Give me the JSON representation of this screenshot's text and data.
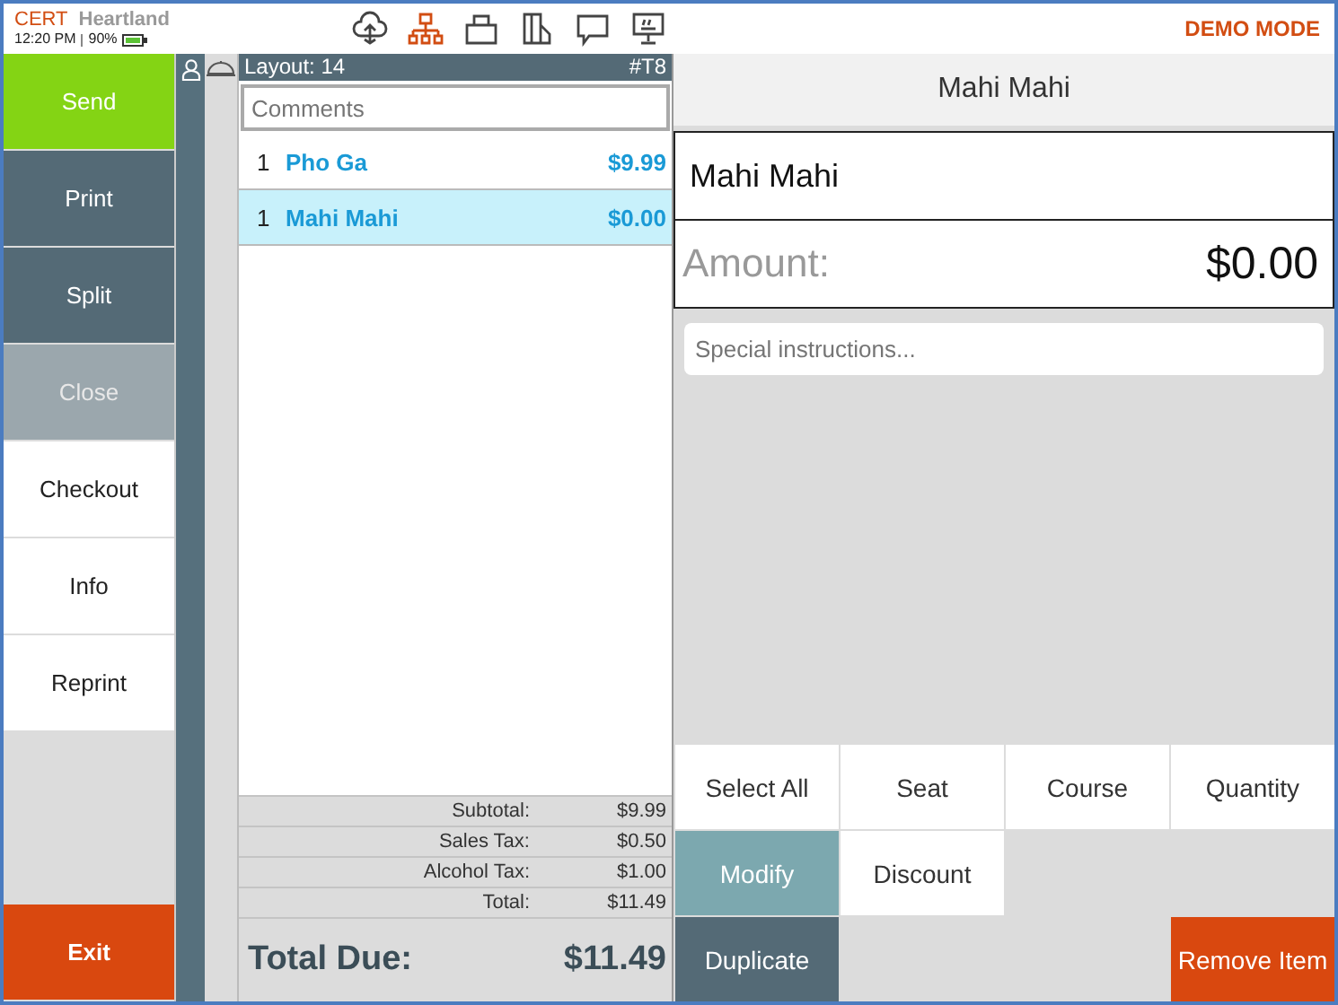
{
  "status": {
    "mode": "CERT",
    "brand": "Heartland",
    "time": "12:20 PM",
    "battery": "90%",
    "demo": "DEMO MODE"
  },
  "toolbar_icons": [
    {
      "kind": "cloud",
      "selected": false
    },
    {
      "kind": "network",
      "selected": true
    },
    {
      "kind": "printer",
      "selected": false
    },
    {
      "kind": "card",
      "selected": false
    },
    {
      "kind": "chat",
      "selected": false
    },
    {
      "kind": "terminal",
      "selected": false
    }
  ],
  "side_buttons": [
    {
      "label": "Send",
      "kind": "primary"
    },
    {
      "label": "Print",
      "kind": "dark"
    },
    {
      "label": "Split",
      "kind": "dark"
    },
    {
      "label": "Close",
      "kind": "disabled"
    },
    {
      "label": "Checkout",
      "kind": "plain"
    },
    {
      "label": "Info",
      "kind": "plain"
    },
    {
      "label": "Reprint",
      "kind": "plain"
    }
  ],
  "exit_button": "Exit",
  "order": {
    "layout": "Layout: 14",
    "table": "#T8",
    "comments_placeholder": "Comments",
    "items": [
      {
        "qty": "1",
        "name": "Pho Ga",
        "price": "$9.99",
        "selected": false
      },
      {
        "qty": "1",
        "name": "Mahi Mahi",
        "price": "$0.00",
        "selected": true
      }
    ],
    "totals": [
      {
        "label": "Subtotal:",
        "value": "$9.99"
      },
      {
        "label": "Sales Tax:",
        "value": "$0.50"
      },
      {
        "label": "Alcohol Tax:",
        "value": "$1.00"
      },
      {
        "label": "Total:",
        "value": "$11.49"
      }
    ],
    "total_due_label": "Total Due:",
    "total_due": "$11.49"
  },
  "detail": {
    "title": "Mahi Mahi",
    "name": "Mahi Mahi",
    "amount_label": "Amount:",
    "amount": "$0.00",
    "placeholder": "Special instructions..."
  },
  "actions": [
    {
      "label": "Select All",
      "kind": "plain"
    },
    {
      "label": "Seat",
      "kind": "plain"
    },
    {
      "label": "Course",
      "kind": "plain"
    },
    {
      "label": "Quantity",
      "kind": "plain"
    },
    {
      "label": "Modify",
      "kind": "teal"
    },
    {
      "label": "Discount",
      "kind": "plain"
    },
    {
      "label": "Duplicate",
      "kind": "dark"
    },
    {
      "label": "Remove Item",
      "kind": "danger"
    }
  ]
}
